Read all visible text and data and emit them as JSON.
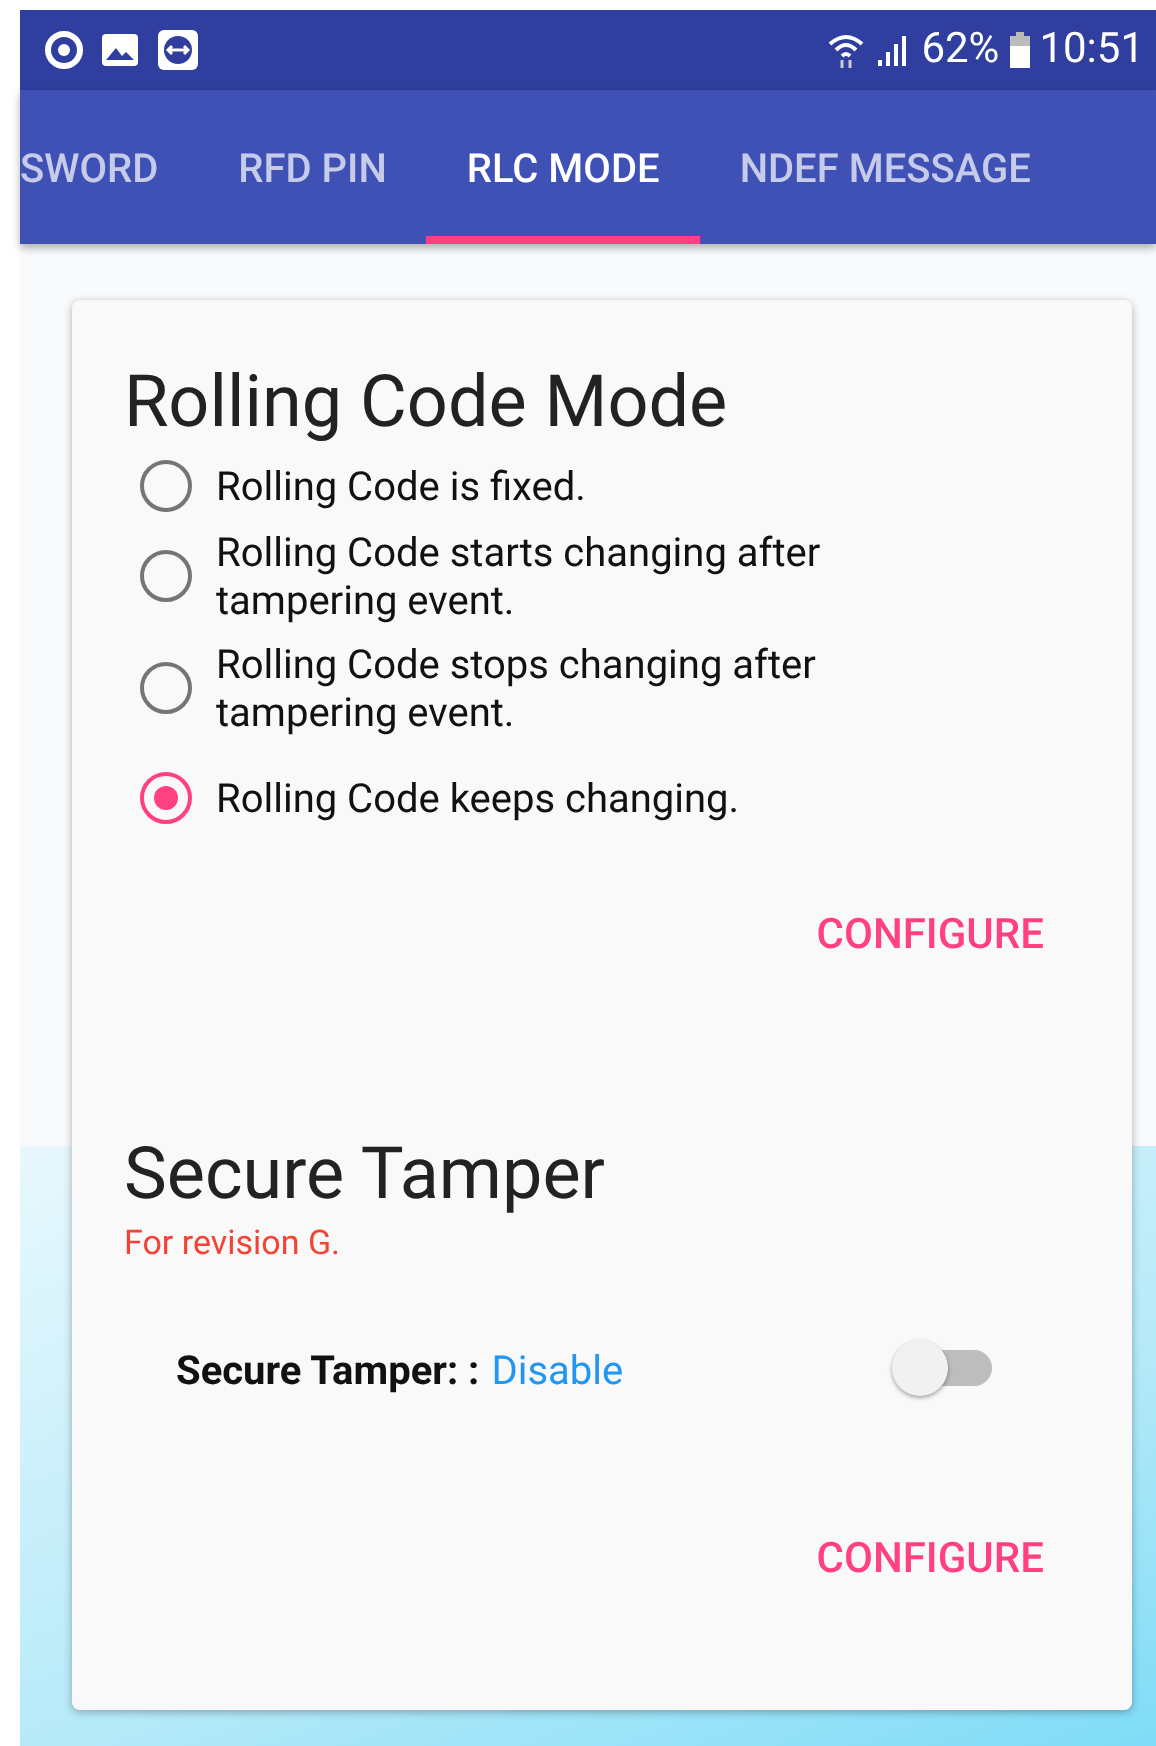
{
  "status_bar": {
    "battery": "62%",
    "time": "10:51"
  },
  "tabs": [
    {
      "label": "SWORD",
      "selected": false
    },
    {
      "label": "RFD PIN",
      "selected": false
    },
    {
      "label": "RLC MODE",
      "selected": true
    },
    {
      "label": "NDEF MESSAGE",
      "selected": false
    }
  ],
  "rolling_code": {
    "title": "Rolling Code Mode",
    "options": [
      {
        "label": "Rolling Code is fixed.",
        "selected": false
      },
      {
        "label": "Rolling Code starts changing after tampering event.",
        "selected": false
      },
      {
        "label": "Rolling Code stops changing after tampering event.",
        "selected": false
      },
      {
        "label": "Rolling Code keeps changing.",
        "selected": true
      }
    ],
    "button": "CONFIGURE"
  },
  "secure_tamper": {
    "title": "Secure Tamper",
    "note": "For revision G.",
    "label": "Secure Tamper: :",
    "value": "Disable",
    "on": false,
    "button": "CONFIGURE"
  }
}
